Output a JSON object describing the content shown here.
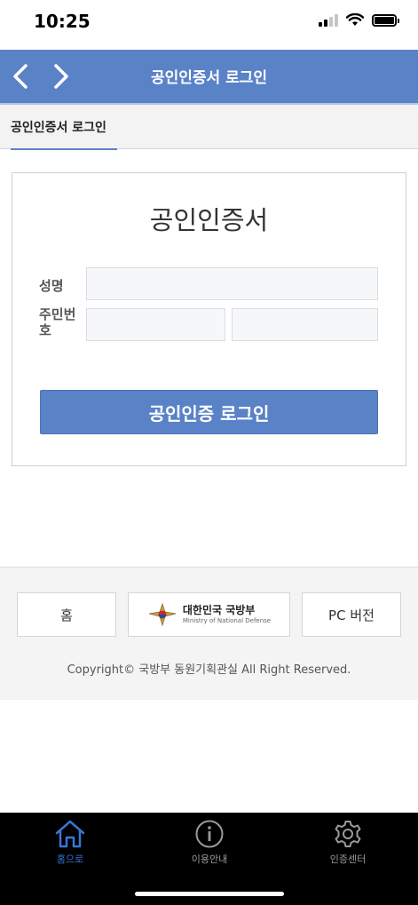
{
  "status_bar": {
    "time": "10:25"
  },
  "header": {
    "title": "공인인증서 로그인"
  },
  "tabs": {
    "active_label": "공인인증서 로그인"
  },
  "login_card": {
    "title": "공인인증서",
    "name_label": "성명",
    "ssn_label": "주민번호",
    "name_value": "",
    "ssn_front_value": "",
    "ssn_back_value": "",
    "login_button_label": "공인인증 로그인"
  },
  "footer": {
    "home_label": "홈",
    "mnd_name_kr": "대한민국 국방부",
    "mnd_name_en": "Ministry of National Defense",
    "pc_label": "PC 버전",
    "copyright": "Copyright© 국방부 동원기획관실 All Right Reserved."
  },
  "bottom_nav": {
    "items": [
      {
        "label": "홈으로",
        "icon": "home-icon",
        "active": true
      },
      {
        "label": "이용안내",
        "icon": "info-icon",
        "active": false
      },
      {
        "label": "인증센터",
        "icon": "gear-icon",
        "active": false
      }
    ]
  },
  "colors": {
    "header_blue": "#5a82c7",
    "active_tab_blue": "#3b74d6",
    "footer_bg": "#f4f4f4"
  }
}
